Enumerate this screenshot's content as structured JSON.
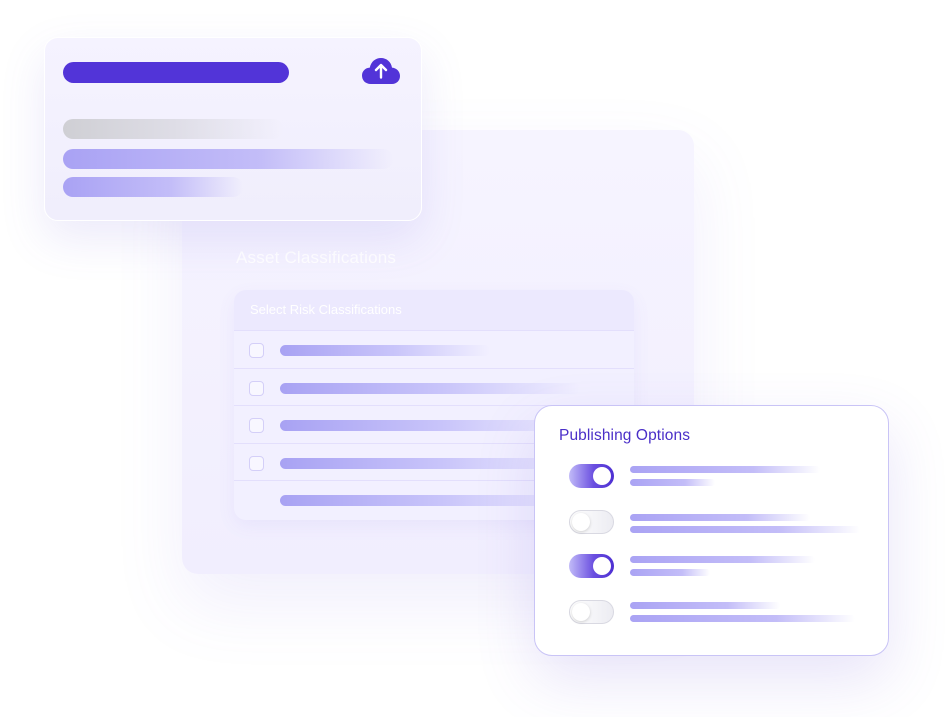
{
  "asset_panel": {
    "title": "Asset Classifications",
    "risk_select": {
      "placeholder": "Select Risk Classifications",
      "options": [
        {
          "checked": false,
          "level": 0.85
        },
        {
          "checked": false,
          "level": 1.0
        },
        {
          "checked": false,
          "level": 1.0
        },
        {
          "checked": false,
          "level": 1.0
        },
        {
          "checked": false,
          "level": 1.0
        }
      ]
    }
  },
  "upload_card": {
    "icon": "cloud-upload-icon",
    "accent_color": "#5234d8"
  },
  "publishing": {
    "title": "Publishing Options",
    "options": [
      {
        "enabled": true
      },
      {
        "enabled": false
      },
      {
        "enabled": true
      },
      {
        "enabled": false
      }
    ]
  },
  "colors": {
    "accent": "#5234d8",
    "title_text": "#4a2fc8",
    "placeholder_bar": "#a9a2f4",
    "border": "#c9c4f6"
  }
}
